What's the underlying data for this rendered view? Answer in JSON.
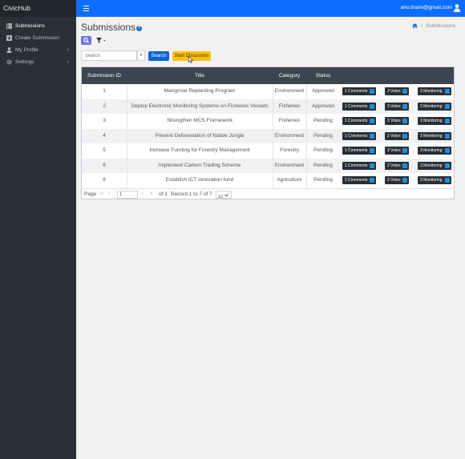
{
  "app": {
    "brand": "CivicHub"
  },
  "sidebar": {
    "items": [
      {
        "label": "Submissions",
        "icon": "list-icon",
        "active": true
      },
      {
        "label": "Create Submission",
        "icon": "plus-square-icon",
        "active": false
      },
      {
        "label": "My Profile",
        "icon": "user-icon",
        "active": false,
        "chevron": "‹"
      },
      {
        "label": "Settings",
        "icon": "gear-icon",
        "active": false,
        "chevron": "‹"
      }
    ]
  },
  "topbar": {
    "user_email": "ano.tisam@gmail.com",
    "accent": "#0d6efd"
  },
  "page": {
    "title": "Submissions",
    "help_glyph": "?",
    "breadcrumb": {
      "current": "Submissions",
      "separator": "/"
    }
  },
  "toolbar": {
    "search_placeholder": "Search",
    "dropdown_glyph": "▾",
    "search_button": "Search",
    "discussion_button": "Start Discussion"
  },
  "table": {
    "columns": [
      "Submission ID",
      "Title",
      "Category",
      "Status"
    ],
    "rows": [
      {
        "id": "1",
        "title": "Mangrove Replanting Program",
        "category": "Environment",
        "status": "Approved",
        "comments": "1 Comments",
        "votes": "3 Votes",
        "monitoring": "3 Monitoring"
      },
      {
        "id": "2",
        "title": "Deploy Electronic Monitoring Systems on Fisheries Vessels",
        "category": "Fisheries",
        "status": "Approved",
        "comments": "1 Comments",
        "votes": "3 Votes",
        "monitoring": "3 Monitoring"
      },
      {
        "id": "3",
        "title": "Strengthen MCS Framework",
        "category": "Fisheries",
        "status": "Pending",
        "comments": "1 Comments",
        "votes": "2 Votes",
        "monitoring": "3 Monitoring"
      },
      {
        "id": "4",
        "title": "Prevent Deforestation of Native Jungle",
        "category": "Environment",
        "status": "Pending",
        "comments": "1 Comments",
        "votes": "2 Votes",
        "monitoring": "3 Monitoring"
      },
      {
        "id": "5",
        "title": "Increase Funding for Forestry Management",
        "category": "Forestry",
        "status": "Pending",
        "comments": "1 Comments",
        "votes": "2 Votes",
        "monitoring": "3 Monitoring"
      },
      {
        "id": "6",
        "title": "Implement Carbon Trading Scheme",
        "category": "Environment",
        "status": "Pending",
        "comments": "1 Comments",
        "votes": "2 Votes",
        "monitoring": "3 Monitoring"
      },
      {
        "id": "8",
        "title": "Establish ICT innovation fund",
        "category": "Agriculture",
        "status": "Pending",
        "comments": "1 Comments",
        "votes": "3 Votes",
        "monitoring": "3 Monitoring"
      }
    ]
  },
  "pager": {
    "page_label": "Page",
    "first": "«",
    "prev": "‹",
    "current_page": "1",
    "next": "›",
    "last": "»",
    "of_label": "of 1",
    "record_label": "Record 1 to 7 of 7",
    "page_size": "10"
  }
}
